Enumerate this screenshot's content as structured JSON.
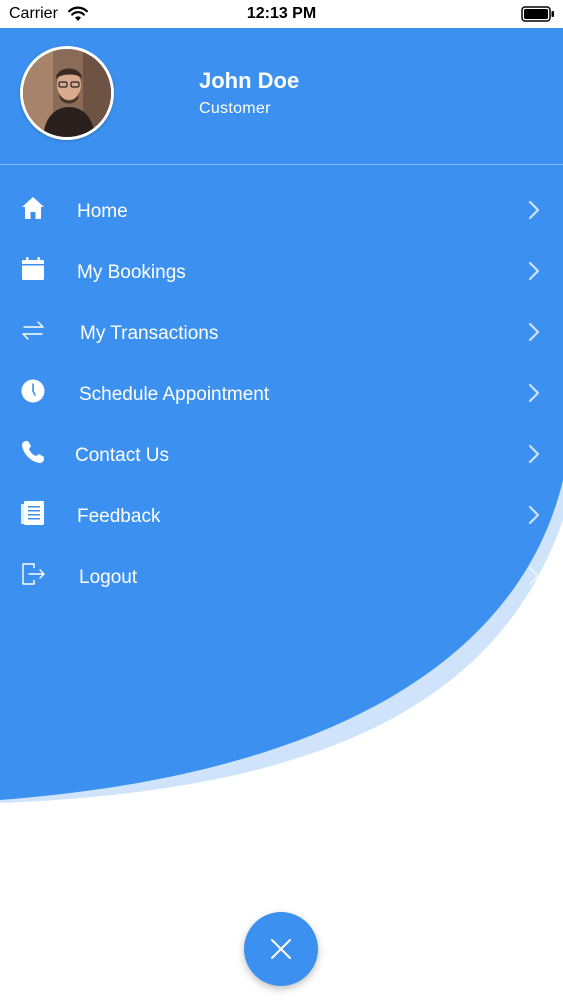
{
  "status_bar": {
    "carrier": "Carrier",
    "time": "12:13 PM",
    "wifi_icon": "wifi-icon",
    "battery_icon": "battery-icon"
  },
  "colors": {
    "primary": "#3c91f0",
    "wave_light": "#cfe3fb",
    "text_on_primary": "#ffffff"
  },
  "profile": {
    "name": "John Doe",
    "role": "Customer",
    "avatar": "avatar-photo"
  },
  "menu": {
    "items": [
      {
        "label": "Home",
        "icon": "home-icon"
      },
      {
        "label": "My Bookings",
        "icon": "calendar-icon"
      },
      {
        "label": "My Transactions",
        "icon": "transfer-icon"
      },
      {
        "label": "Schedule Appointment",
        "icon": "clock-icon"
      },
      {
        "label": "Contact Us",
        "icon": "phone-icon"
      },
      {
        "label": "Feedback",
        "icon": "document-icon"
      },
      {
        "label": "Logout",
        "icon": "logout-icon"
      }
    ]
  },
  "fab": {
    "icon": "close-icon"
  }
}
